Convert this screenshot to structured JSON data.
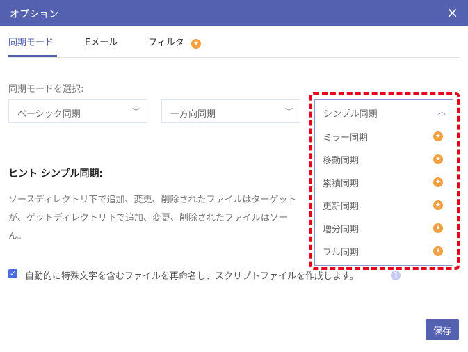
{
  "window": {
    "title": "オプション",
    "close_icon": "×"
  },
  "tabs": [
    {
      "label": "同期モード"
    },
    {
      "label": "Eメール"
    },
    {
      "label": "フィルタ"
    }
  ],
  "sync": {
    "label": "同期モードを選択:",
    "selects": [
      {
        "value": "ベーシック同期"
      },
      {
        "value": "一方向同期"
      },
      {
        "value": "シンプル同期"
      }
    ],
    "options": [
      {
        "label": "ミラー同期"
      },
      {
        "label": "移動同期"
      },
      {
        "label": "累積同期"
      },
      {
        "label": "更新同期"
      },
      {
        "label": "増分同期"
      },
      {
        "label": "フル同期"
      }
    ]
  },
  "hint": {
    "title": "ヒント シンプル同期:",
    "lines": [
      "ソースディレクトリ下で追加、変更、削除されたファイルはターゲット",
      "が、ゲットディレクトリ下で追加、変更、削除されたファイルはソー",
      "ん。"
    ]
  },
  "checkbox": {
    "label": "自動的に特殊文字を含むファイルを再命名し、スクリプトファイルを作成します。",
    "checked": true,
    "help": "?"
  },
  "footer": {
    "save_label": "保存"
  },
  "colors": {
    "accent": "#5461b1",
    "premium": "#f5a040",
    "highlight": "#e8001b"
  }
}
